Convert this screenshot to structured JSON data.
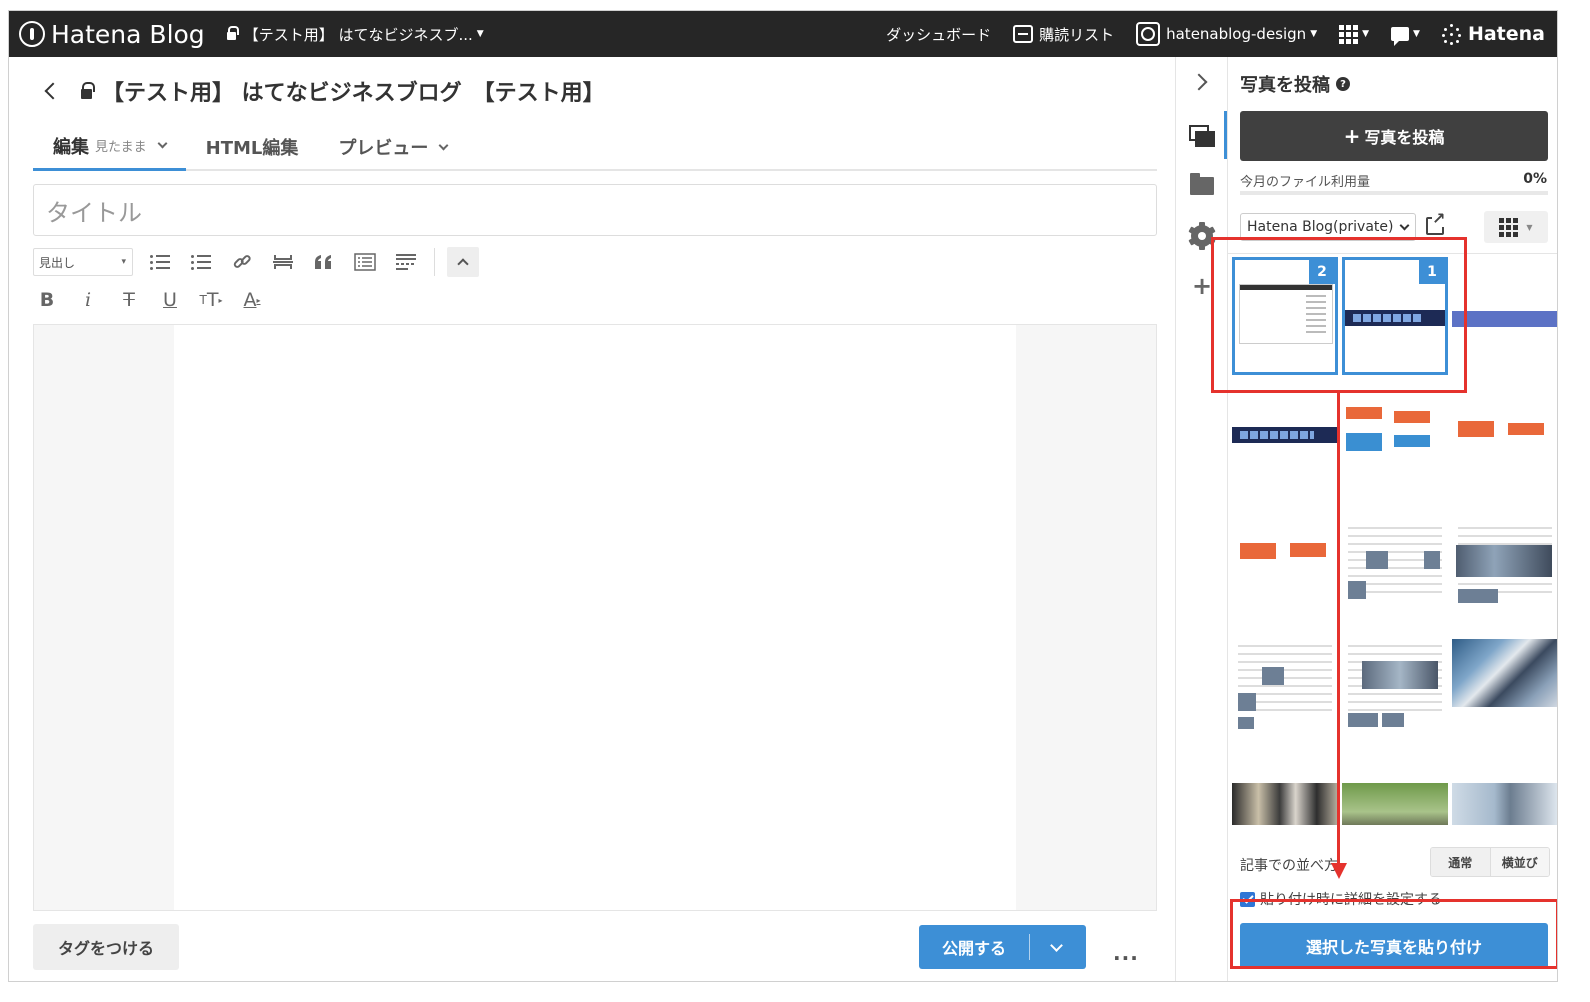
{
  "topbar": {
    "logo": "Hatena Blog",
    "blog_selector": "【テスト用】 はてなビジネスブ...",
    "dashboard": "ダッシュボード",
    "subscriptions": "購読リスト",
    "user": "hatenablog-design",
    "brand": "Hatena"
  },
  "editor": {
    "heading": "【テスト用】 はてなビジネスブログ　【テスト用】",
    "tabs": [
      {
        "label": "編集",
        "sub": "見たまま"
      },
      {
        "label": "HTML編集"
      },
      {
        "label": "プレビュー"
      }
    ],
    "title_placeholder": "タイトル",
    "heading_select": "見出し",
    "format_glyphs": {
      "bold": "B",
      "italic": "i",
      "strike": "T",
      "underline": "U",
      "size": "T",
      "color": "A"
    },
    "tag_button": "タグをつける",
    "publish_button": "公開する",
    "more": "..."
  },
  "panel": {
    "title": "写真を投稿",
    "post_button": "写真を投稿",
    "usage_label": "今月のファイル利用量",
    "usage_value": "0%",
    "usage_fraction": 0,
    "album": "Hatena Blog(private)",
    "selected_badges": [
      "2",
      "1"
    ],
    "arrange_label": "記事での並べ方",
    "arrange_options": [
      "通常",
      "横並び"
    ],
    "detail_checkbox": "貼り付け時に詳細を設定する",
    "paste_button": "選択した写真を貼り付け"
  },
  "colors": {
    "accent": "#3d8fd6",
    "annotation": "#e5322d",
    "topbar": "#262626"
  }
}
